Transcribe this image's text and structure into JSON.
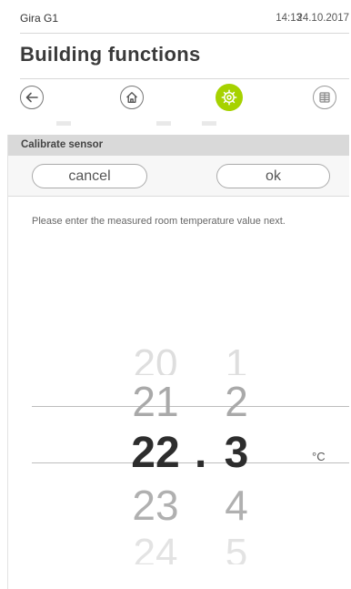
{
  "status": {
    "device": "Gira G1",
    "time": "14:13",
    "date": "24.10.2017"
  },
  "page": {
    "title": "Building functions"
  },
  "nav": {
    "back_icon": "back-arrow-icon",
    "home_icon": "home-icon",
    "settings_icon": "settings-gear-icon",
    "tiles_icon": "tile-grid-icon",
    "active_color": "#a6d200"
  },
  "dialog": {
    "title": "Calibrate sensor",
    "cancel_label": "cancel",
    "ok_label": "ok",
    "instruction": "Please enter the measured room temperature value next."
  },
  "picker": {
    "integer_values": [
      "20",
      "21",
      "22",
      "23",
      "24"
    ],
    "decimal_values": [
      "1",
      "2",
      "3",
      "4",
      "5"
    ],
    "separator": ".",
    "selected_integer": "22",
    "selected_decimal": "3",
    "unit": "°C"
  }
}
